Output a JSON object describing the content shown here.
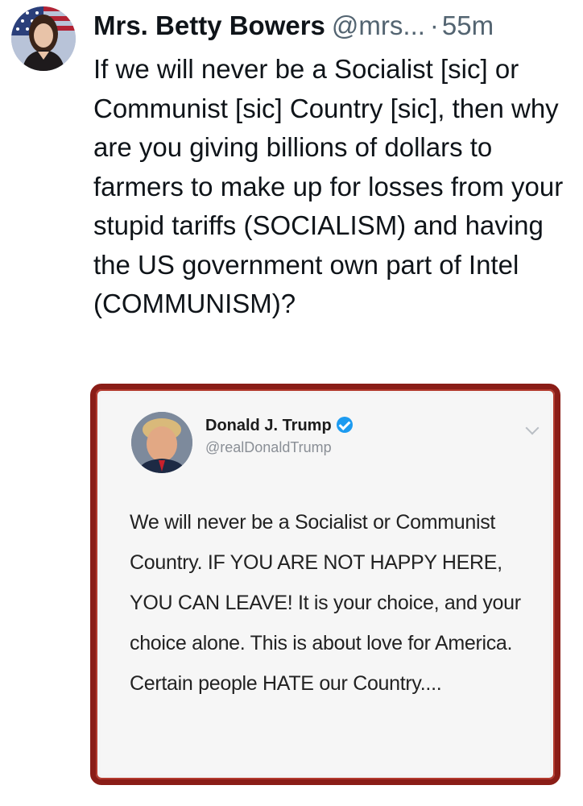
{
  "tweet": {
    "display_name": "Mrs. Betty Bowers",
    "handle": "@mrs...",
    "separator": "·",
    "time": "55m",
    "text": "If we will never be a Socialist [sic] or Communist [sic] Country [sic], then why are you giving billions of dollars to farmers to make up for losses from your stupid tariffs (SOCIALISM) and having the US government own part of Intel (COMMUNISM)?"
  },
  "embedded_tweet": {
    "display_name": "Donald J. Trump",
    "handle": "@realDonaldTrump",
    "text": "We will never be a Socialist or Communist Country. IF YOU ARE NOT HAPPY HERE, YOU CAN LEAVE! It is your choice, and your choice alone. This is about love for America. Certain people HATE our Country....",
    "border_color": "#8a1d17",
    "verified_color": "#1d9bf0"
  }
}
